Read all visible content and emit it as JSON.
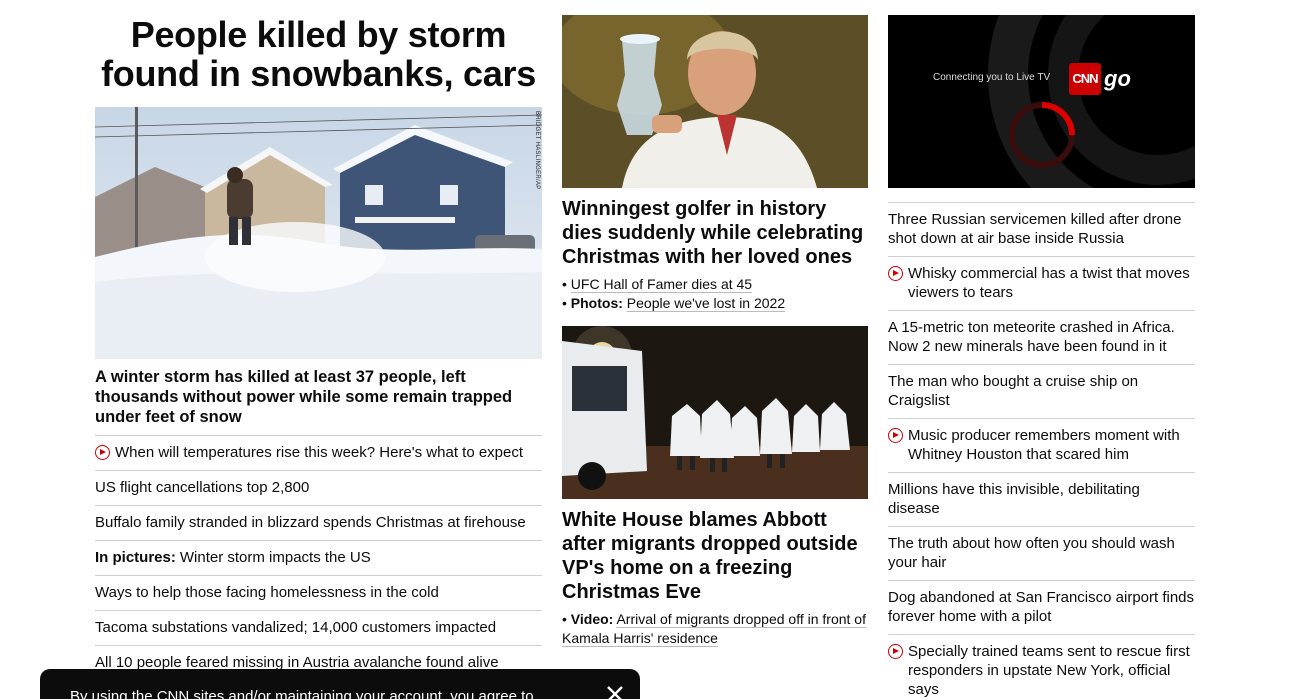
{
  "left": {
    "headline": "People killed by storm found in snowbanks, cars",
    "image_credit": "BRIDGET HASLINGER/AP",
    "lead_text": "A winter storm has killed at least 37 people, left thousands without power while some remain trapped under feet of snow",
    "items": [
      {
        "prefix": "",
        "text": "When will temperatures rise this week? Here's what to expect",
        "video": true
      },
      {
        "prefix": "",
        "text": "US flight cancellations top 2,800",
        "video": false
      },
      {
        "prefix": "",
        "text": "Buffalo family stranded in blizzard spends Christmas at firehouse",
        "video": false
      },
      {
        "prefix": "In pictures:",
        "text": "Winter storm impacts the US",
        "video": false
      },
      {
        "prefix": "",
        "text": "Ways to help those facing homelessness in the cold",
        "video": false
      },
      {
        "prefix": "",
        "text": "Tacoma substations vandalized; 14,000 customers impacted",
        "video": false
      },
      {
        "prefix": "",
        "text": "All 10 people feared missing in Austria avalanche found alive",
        "video": false
      }
    ]
  },
  "mid": {
    "story1_title": "Winningest golfer in history dies suddenly while celebrating Christmas with her loved ones",
    "story1_bullets": [
      {
        "prefix": "",
        "text": "UFC Hall of Famer dies at 45"
      },
      {
        "prefix": "Photos:",
        "text": "People we've lost in 2022"
      }
    ],
    "story2_title": "White House blames Abbott after migrants dropped outside VP's home on a freezing Christmas Eve",
    "story2_bullets": [
      {
        "prefix": "Video:",
        "text": "Arrival of migrants dropped off in front of Kamala Harris' residence"
      }
    ]
  },
  "right": {
    "video_text": "Connecting you to Live TV",
    "brand_logo": "CNN",
    "brand_go": "go",
    "items": [
      {
        "text": "Three Russian servicemen killed after drone shot down at air base inside Russia",
        "video": false
      },
      {
        "text": "Whisky commercial has a twist that moves viewers to tears",
        "video": true
      },
      {
        "text": "A 15-metric ton meteorite crashed in Africa. Now 2 new minerals have been found in it",
        "video": false
      },
      {
        "text": "The man who bought a cruise ship on Craigslist",
        "video": false
      },
      {
        "text": "Music producer remembers moment with Whitney Houston that scared him",
        "video": true
      },
      {
        "text": "Millions have this invisible, debilitating disease",
        "video": false
      },
      {
        "text": "The truth about how often you should wash your hair",
        "video": false
      },
      {
        "text": "Dog abandoned at San Francisco airport finds forever home with a pilot",
        "video": false
      },
      {
        "text": "Specially trained teams sent to rescue first responders in upstate New York, official says",
        "video": true
      }
    ]
  },
  "consent": {
    "text": "By using the CNN sites and/or maintaining your account, you agree to"
  },
  "colors": {
    "accent": "#cc0000",
    "text": "#0c0c0c",
    "divider": "#d0d0d0"
  }
}
